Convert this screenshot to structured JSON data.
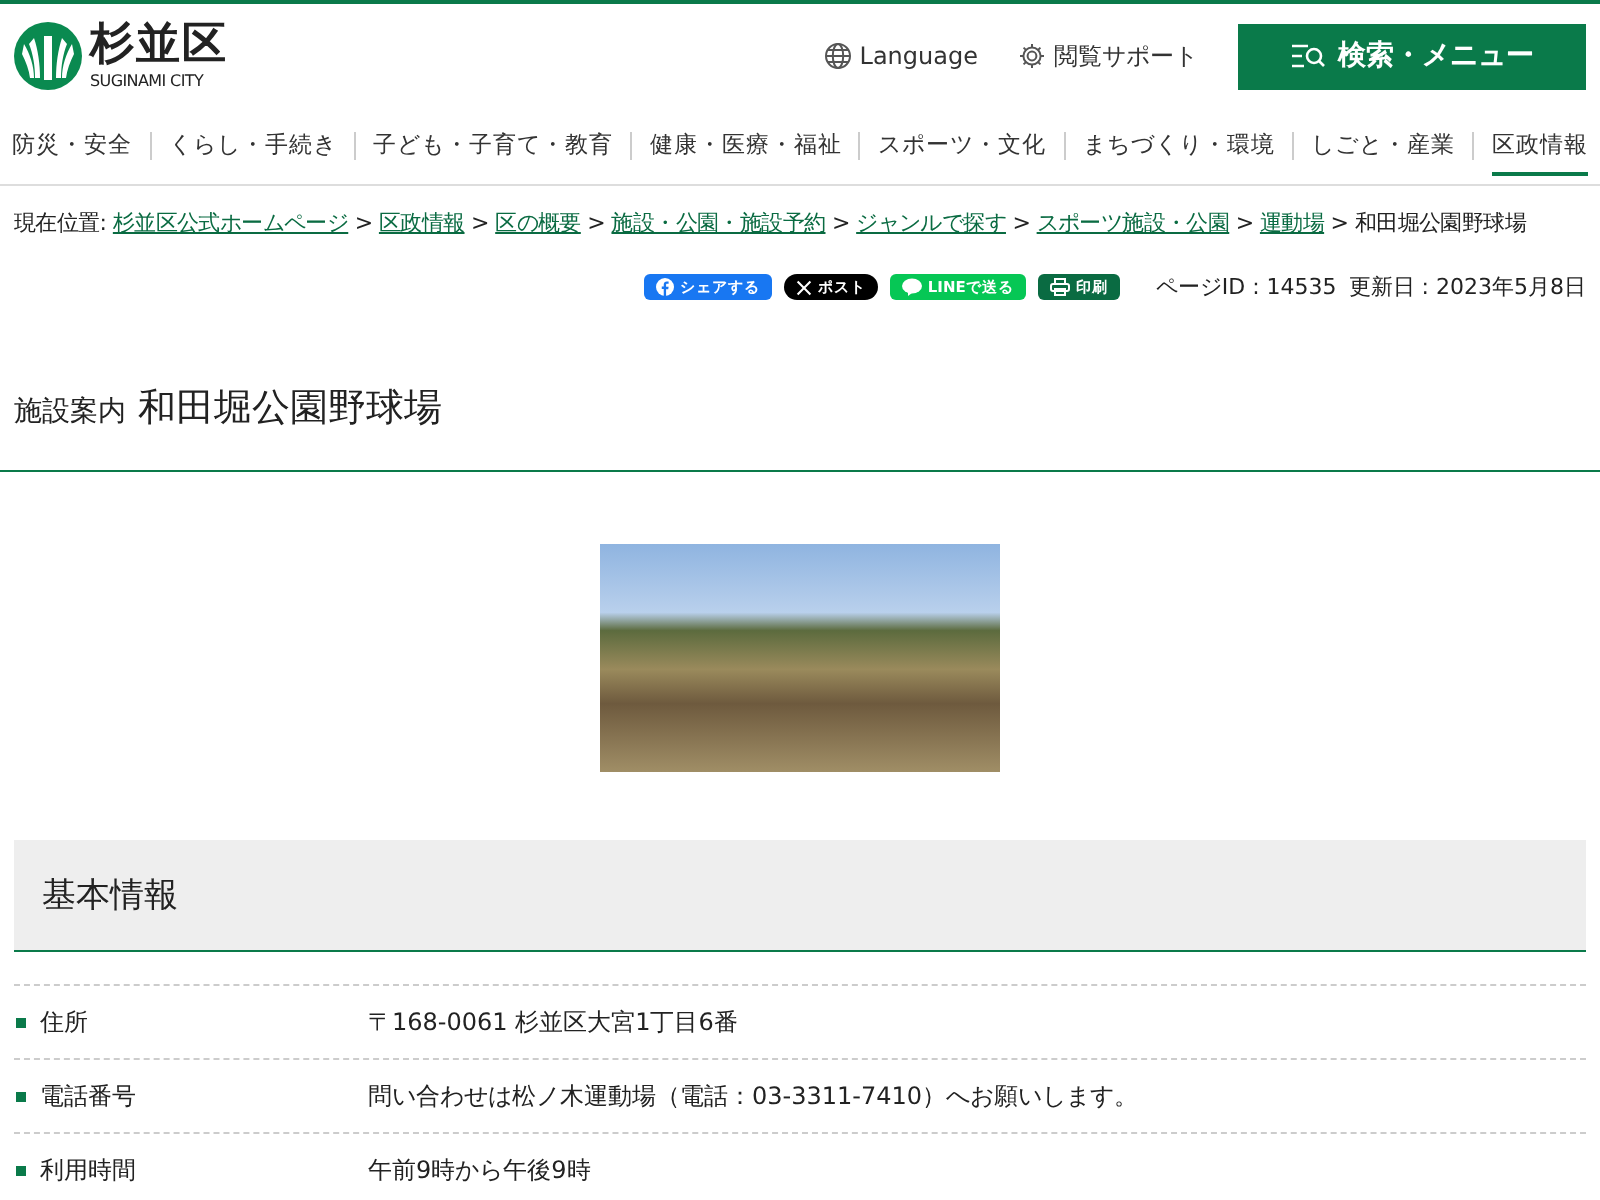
{
  "header": {
    "logo_text": "杉並区",
    "logo_subtext": "SUGINAMI CITY",
    "links": [
      {
        "label": "Language",
        "kind": "globe"
      },
      {
        "label": "閲覧サポート",
        "kind": "gear"
      }
    ],
    "menu_button": "検索・メニュー"
  },
  "nav": [
    {
      "label": "防災・安全",
      "selected": false
    },
    {
      "label": "くらし・手続き",
      "selected": false
    },
    {
      "label": "子ども・子育て・教育",
      "selected": false
    },
    {
      "label": "健康・医療・福祉",
      "selected": false
    },
    {
      "label": "スポーツ・文化",
      "selected": false
    },
    {
      "label": "まちづくり・環境",
      "selected": false
    },
    {
      "label": "しごと・産業",
      "selected": false
    },
    {
      "label": "区政情報",
      "selected": true
    }
  ],
  "breadcrumb": [
    {
      "kind": "prefix",
      "text": "現在位置:"
    },
    {
      "kind": "link",
      "text": "杉並区公式ホームページ"
    },
    {
      "kind": "sep",
      "text": ">"
    },
    {
      "kind": "link",
      "text": "区政情報"
    },
    {
      "kind": "sep",
      "text": ">"
    },
    {
      "kind": "link",
      "text": "区の概要"
    },
    {
      "kind": "sep",
      "text": ">"
    },
    {
      "kind": "link",
      "text": "施設・公園・施設予約"
    },
    {
      "kind": "sep",
      "text": ">"
    },
    {
      "kind": "link",
      "text": "ジャンルで探す"
    },
    {
      "kind": "sep",
      "text": ">"
    },
    {
      "kind": "link",
      "text": "スポーツ施設・公園"
    },
    {
      "kind": "sep",
      "text": ">"
    },
    {
      "kind": "link",
      "text": "運動場"
    },
    {
      "kind": "sep",
      "text": ">"
    },
    {
      "kind": "current",
      "text": "和田堀公園野球場"
    }
  ],
  "share": [
    {
      "label": "シェアする",
      "kind": "facebook"
    },
    {
      "label": "ポスト",
      "kind": "x"
    },
    {
      "label": "LINEで送る",
      "kind": "line"
    },
    {
      "label": "印刷",
      "kind": "print"
    }
  ],
  "page_id": "ページID : 14535",
  "updated": "更新日 : 2023年5月8日",
  "title": {
    "category": "施設案内",
    "name": "和田堀公園野球場"
  },
  "section": {
    "heading": "基本情報",
    "rows": [
      {
        "label": "住所",
        "value": "〒168-0061 杉並区大宮1丁目6番"
      },
      {
        "label": "電話番号",
        "value": "問い合わせは松ノ木運動場（電話：03-3311-7410）へお願いします。"
      },
      {
        "label": "利用時間",
        "value": "午前9時から午後9時"
      }
    ]
  }
}
